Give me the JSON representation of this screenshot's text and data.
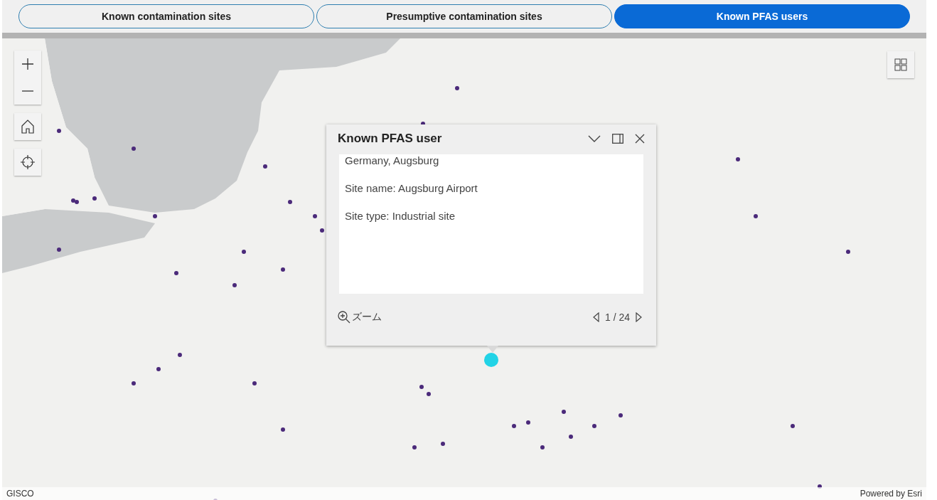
{
  "tabs": [
    {
      "label": "Known contamination sites",
      "selected": false
    },
    {
      "label": "Presumptive contamination sites",
      "selected": false
    },
    {
      "label": "Known PFAS users",
      "selected": true
    }
  ],
  "map": {
    "attribution_left": "GISCO",
    "attribution_right": "Powered by Esri"
  },
  "popup": {
    "title": "Known PFAS user",
    "lines": [
      "Germany, Augsburg",
      "Site name: Augsburg Airport",
      "Site type: Industrial site"
    ],
    "zoom_label": "ズーム",
    "pager": "1 / 24"
  }
}
